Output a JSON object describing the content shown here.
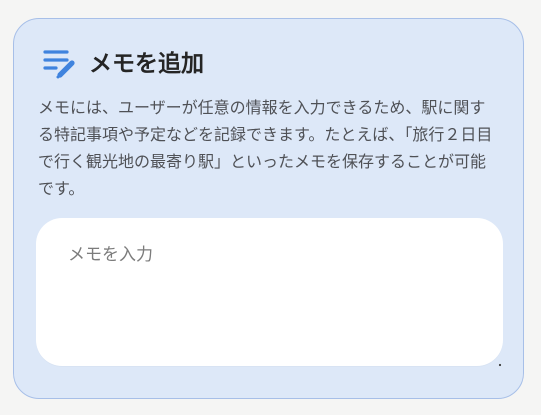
{
  "memo_card": {
    "icon": "memo-pencil-icon",
    "title": "メモを追加",
    "description": "メモには、ユーザーが任意の情報を入力できるため、駅に関する特記事項や予定などを記録できます。たとえば、「旅行２日目で行く観光地の最寄り駅」といったメモを保存することが可能です。",
    "input": {
      "value": "",
      "placeholder": "メモを入力"
    },
    "resize_handle_icon": "resize-handle-icon"
  },
  "colors": {
    "page_background": "#f5f5f4",
    "card_background": "#dde8f8",
    "card_border": "#a7bfe8",
    "icon_accent": "#3f83de",
    "title_text": "#252525",
    "body_text": "#4f5156",
    "input_background": "#ffffff",
    "placeholder_text": "#7c7c7c"
  }
}
